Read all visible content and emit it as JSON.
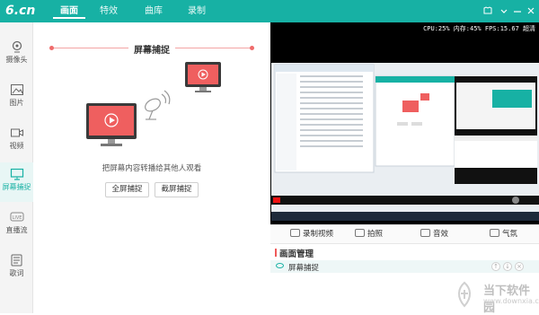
{
  "app": {
    "logo": "6.cn"
  },
  "tabs": [
    {
      "label": "画面",
      "active": true
    },
    {
      "label": "特效",
      "active": false
    },
    {
      "label": "曲库",
      "active": false
    },
    {
      "label": "录制",
      "active": false
    }
  ],
  "sidebar": {
    "items": [
      {
        "label": "摄像头",
        "icon": "camera-icon"
      },
      {
        "label": "图片",
        "icon": "image-icon"
      },
      {
        "label": "视频",
        "icon": "video-icon"
      },
      {
        "label": "屏幕捕捉",
        "icon": "monitor-icon",
        "active": true
      },
      {
        "label": "直播流",
        "icon": "live-icon"
      },
      {
        "label": "歌词",
        "icon": "lyrics-icon"
      }
    ]
  },
  "main": {
    "title": "屏幕捕捉",
    "description": "把屏幕内容转播给其他人观看",
    "buttons": {
      "full": "全屏捕捉",
      "region": "截屏捕捉"
    }
  },
  "preview": {
    "stats": "CPU:25% 内存:45% FPS:15.67 超清"
  },
  "actions": {
    "record": "录制视频",
    "photo": "拍照",
    "sound": "音效",
    "atmosphere": "气氛"
  },
  "scene": {
    "header": "画面管理",
    "items": [
      {
        "label": "屏幕捕捉"
      }
    ]
  },
  "watermark": {
    "name": "当下软件园",
    "sub": "www.downxia.com"
  },
  "colors": {
    "accent": "#17b1a4",
    "red": "#ef5a5a"
  }
}
